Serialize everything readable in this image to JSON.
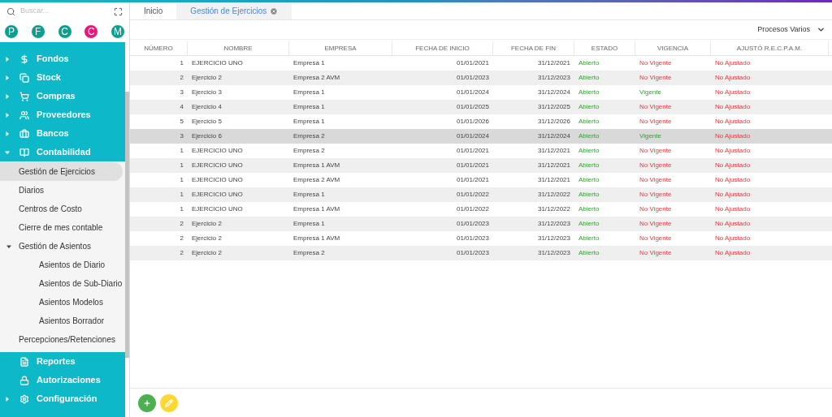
{
  "sidebar": {
    "search": {
      "placeholder": "Buscar..."
    },
    "avatars": [
      {
        "letter": "P",
        "color": "#0f9d8f"
      },
      {
        "letter": "F",
        "color": "#0f9d8f"
      },
      {
        "letter": "C",
        "color": "#0f9d8f"
      },
      {
        "letter": "C",
        "color": "#e5197a"
      },
      {
        "letter": "M",
        "color": "#0f9d8f"
      }
    ],
    "items": [
      {
        "label": "Fondos",
        "kind": "dollar",
        "expanded": false
      },
      {
        "label": "Stock",
        "kind": "box",
        "expanded": false
      },
      {
        "label": "Compras",
        "kind": "cart",
        "expanded": false
      },
      {
        "label": "Proveedores",
        "kind": "people",
        "expanded": false
      },
      {
        "label": "Bancos",
        "kind": "briefcase",
        "expanded": false
      },
      {
        "label": "Contabilidad",
        "kind": "book",
        "expanded": true,
        "children": [
          {
            "label": "Gestión de Ejercicios",
            "selected": true
          },
          {
            "label": "Diarios",
            "selected": false
          },
          {
            "label": "Centros de Costo",
            "selected": false
          },
          {
            "label": "Cierre de mes contable",
            "selected": false
          },
          {
            "label": "Gestión de Asientos",
            "selected": false,
            "expanded": true,
            "children": [
              {
                "label": "Asientos de Diario",
                "selected": false
              },
              {
                "label": "Asientos de Sub-Diario",
                "selected": false
              },
              {
                "label": "Asientos Modelos",
                "selected": false
              },
              {
                "label": "Asientos Borrador",
                "selected": false
              }
            ]
          },
          {
            "label": "Percepciones/Retenciones",
            "selected": false
          }
        ]
      },
      {
        "label": "Reportes",
        "kind": "file"
      },
      {
        "label": "Autorizaciones",
        "kind": "lock"
      },
      {
        "label": "Configuración",
        "kind": "gears",
        "expanded": false
      }
    ]
  },
  "tabs": [
    {
      "label": "Inicio",
      "selected": false,
      "closable": false
    },
    {
      "label": "Gestión de Ejercicios",
      "selected": true,
      "closable": true
    }
  ],
  "toolbar": {
    "menu": "Procesos Varios"
  },
  "table": {
    "columns": [
      "NÚMERO",
      "NOMBRE",
      "EMPRESA",
      "FECHA DE INICIO",
      "FECHA DE FIN",
      "ESTADO",
      "VIGENCIA",
      "AJUSTÓ R.E.C.P.A.M."
    ],
    "rows": [
      {
        "numero": "1",
        "nombre": "EJERCICIO UNO",
        "empresa": "Empresa 1",
        "inicio": "01/01/2021",
        "fin": "31/12/2021",
        "estado": "Abierto",
        "abierto": true,
        "vigencia": "No Vigente",
        "vigente": false,
        "ajuste": "No Ajustado",
        "ajustado": false,
        "selected": false
      },
      {
        "numero": "2",
        "nombre": "Ejercicio 2",
        "empresa": "Empresa 2 AVM",
        "inicio": "01/01/2023",
        "fin": "31/12/2023",
        "estado": "Abierto",
        "abierto": true,
        "vigencia": "No Vigente",
        "vigente": false,
        "ajuste": "No Ajustado",
        "ajustado": false,
        "selected": false
      },
      {
        "numero": "3",
        "nombre": "Ejercicio 3",
        "empresa": "Empresa 1",
        "inicio": "01/01/2024",
        "fin": "31/12/2024",
        "estado": "Abierto",
        "abierto": true,
        "vigencia": "Vigente",
        "vigente": true,
        "ajuste": "No Ajustado",
        "ajustado": false,
        "selected": false
      },
      {
        "numero": "4",
        "nombre": "Ejercicio 4",
        "empresa": "Empresa 1",
        "inicio": "01/01/2025",
        "fin": "31/12/2025",
        "estado": "Abierto",
        "abierto": true,
        "vigencia": "No Vigente",
        "vigente": false,
        "ajuste": "No Ajustado",
        "ajustado": false,
        "selected": false
      },
      {
        "numero": "5",
        "nombre": "Ejercicio 5",
        "empresa": "Empresa 1",
        "inicio": "01/01/2026",
        "fin": "31/12/2026",
        "estado": "Abierto",
        "abierto": true,
        "vigencia": "No Vigente",
        "vigente": false,
        "ajuste": "No Ajustado",
        "ajustado": false,
        "selected": false
      },
      {
        "numero": "3",
        "nombre": "Ejercicio 6",
        "empresa": "Empresa 2",
        "inicio": "01/01/2024",
        "fin": "31/12/2024",
        "estado": "Abierto",
        "abierto": true,
        "vigencia": "Vigente",
        "vigente": true,
        "ajuste": "No Ajustado",
        "ajustado": false,
        "selected": true
      },
      {
        "numero": "1",
        "nombre": "EJERCICIO UNO",
        "empresa": "Empresa 2",
        "inicio": "01/01/2021",
        "fin": "31/12/2021",
        "estado": "Abierto",
        "abierto": true,
        "vigencia": "No Vigente",
        "vigente": false,
        "ajuste": "No Ajustado",
        "ajustado": false,
        "selected": false
      },
      {
        "numero": "1",
        "nombre": "EJERCICIO UNO",
        "empresa": "Empresa 1 AVM",
        "inicio": "01/01/2021",
        "fin": "31/12/2021",
        "estado": "Abierto",
        "abierto": true,
        "vigencia": "No Vigente",
        "vigente": false,
        "ajuste": "No Ajustado",
        "ajustado": false,
        "selected": false
      },
      {
        "numero": "1",
        "nombre": "EJERCICIO UNO",
        "empresa": "Empresa 2 AVM",
        "inicio": "01/01/2021",
        "fin": "31/12/2021",
        "estado": "Abierto",
        "abierto": true,
        "vigencia": "No Vigente",
        "vigente": false,
        "ajuste": "No Ajustado",
        "ajustado": false,
        "selected": false
      },
      {
        "numero": "1",
        "nombre": "EJERCICIO UNO",
        "empresa": "Empresa 1",
        "inicio": "01/01/2022",
        "fin": "31/12/2022",
        "estado": "Abierto",
        "abierto": true,
        "vigencia": "No Vigente",
        "vigente": false,
        "ajuste": "No Ajustado",
        "ajustado": false,
        "selected": false
      },
      {
        "numero": "1",
        "nombre": "EJERCICIO UNO",
        "empresa": "Empresa 1 AVM",
        "inicio": "01/01/2022",
        "fin": "31/12/2022",
        "estado": "Abierto",
        "abierto": true,
        "vigencia": "No Vigente",
        "vigente": false,
        "ajuste": "No Ajustado",
        "ajustado": false,
        "selected": false
      },
      {
        "numero": "2",
        "nombre": "Ejercicio 2",
        "empresa": "Empresa 1",
        "inicio": "01/01/2023",
        "fin": "31/12/2023",
        "estado": "Abierto",
        "abierto": true,
        "vigencia": "No Vigente",
        "vigente": false,
        "ajuste": "No Ajustado",
        "ajustado": false,
        "selected": false
      },
      {
        "numero": "2",
        "nombre": "Ejercicio 2",
        "empresa": "Empresa 1 AVM",
        "inicio": "01/01/2023",
        "fin": "31/12/2023",
        "estado": "Abierto",
        "abierto": true,
        "vigencia": "No Vigente",
        "vigente": false,
        "ajuste": "No Ajustado",
        "ajustado": false,
        "selected": false
      },
      {
        "numero": "2",
        "nombre": "Ejercicio 2",
        "empresa": "Empresa 2",
        "inicio": "01/01/2023",
        "fin": "31/12/2023",
        "estado": "Abierto",
        "abierto": true,
        "vigencia": "No Vigente",
        "vigente": false,
        "ajuste": "No Ajustado",
        "ajustado": false,
        "selected": false
      }
    ]
  },
  "actions": [
    {
      "kind": "add"
    },
    {
      "kind": "edit"
    }
  ]
}
